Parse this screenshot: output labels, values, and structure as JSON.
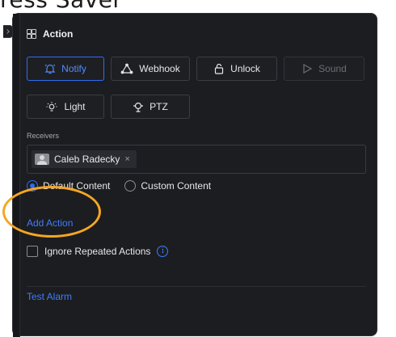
{
  "background": {
    "title_fragment": "ress Saver"
  },
  "panel": {
    "header": {
      "title": "Action",
      "icon": "grid-icon"
    },
    "actions": [
      {
        "label": "Notify",
        "icon": "bell-icon",
        "state": "active"
      },
      {
        "label": "Webhook",
        "icon": "webhook-icon",
        "state": "normal"
      },
      {
        "label": "Unlock",
        "icon": "unlock-icon",
        "state": "normal"
      },
      {
        "label": "Sound",
        "icon": "play-icon",
        "state": "disabled"
      },
      {
        "label": "Light",
        "icon": "light-icon",
        "state": "normal"
      },
      {
        "label": "PTZ",
        "icon": "ptz-icon",
        "state": "normal"
      }
    ],
    "receivers": {
      "label": "Receivers",
      "chips": [
        {
          "name": "Caleb Radecky",
          "remove": "×"
        }
      ]
    },
    "content_options": {
      "default": "Default Content",
      "custom": "Custom Content",
      "selected": "default"
    },
    "add_action": "Add Action",
    "ignore_repeated": {
      "label": "Ignore Repeated Actions",
      "checked": false,
      "info": "i"
    },
    "test_alarm": "Test Alarm"
  },
  "colors": {
    "panel_bg": "#1c1d20",
    "accent": "#2f6df0",
    "link": "#3d7cff",
    "highlight": "#f5a623"
  }
}
